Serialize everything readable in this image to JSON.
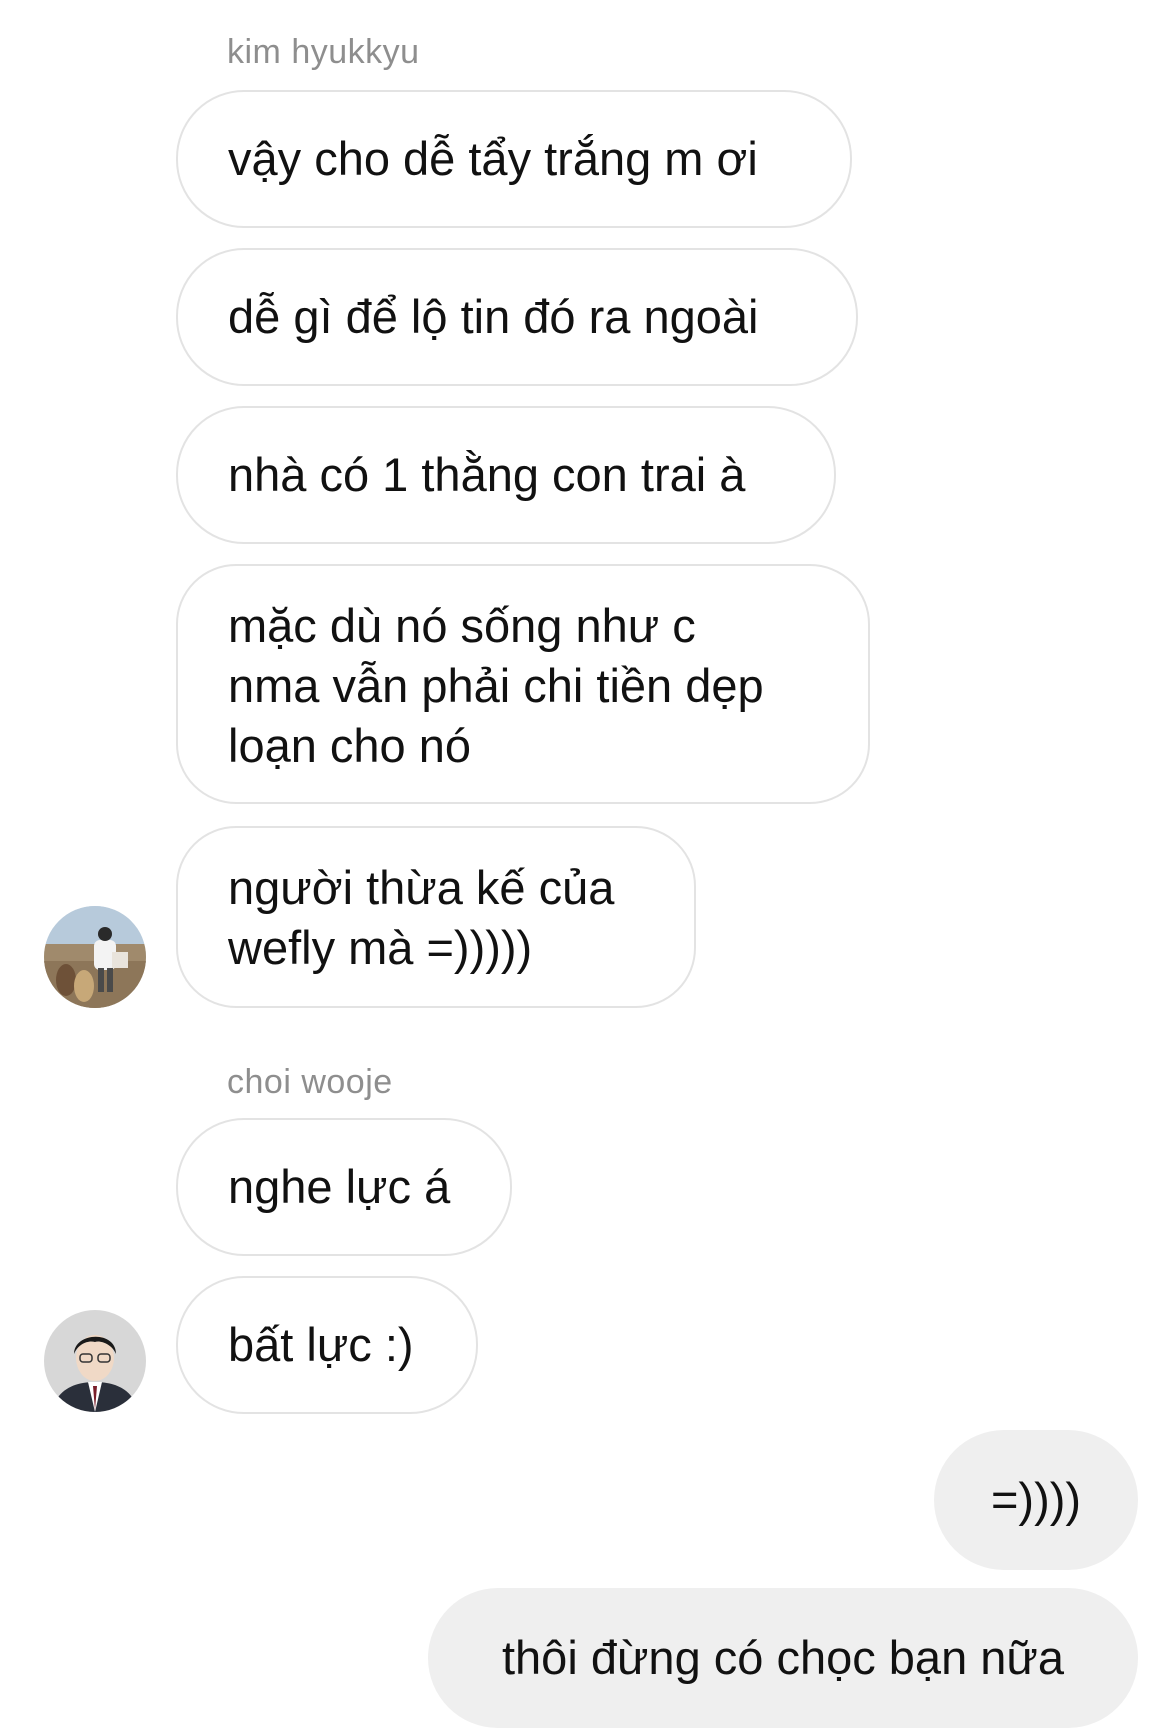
{
  "groups": [
    {
      "sender": "kim hyukkyu",
      "messages": [
        "vậy cho dễ tẩy trắng m ơi",
        "dễ gì để lộ tin đó ra ngoài",
        "nhà có 1 thằng con trai à",
        " mặc dù nó sống như c\nnma vẫn phải chi tiền dẹp\nloạn cho nó",
        "người thừa kế của\nwefly mà =)))))"
      ],
      "avatar": "avatar-photo-person-with-alpacas"
    },
    {
      "sender": "choi wooje",
      "messages": [
        "nghe lực á",
        "bất lực :)"
      ],
      "avatar": "avatar-photo-person-in-suit"
    }
  ],
  "outgoing": [
    "=))))",
    "thôi đừng có chọc bạn nữa"
  ],
  "colors": {
    "incoming_border": "#e3e3e3",
    "outgoing_bg": "#efefef",
    "sender_name": "#8e8e8e"
  }
}
